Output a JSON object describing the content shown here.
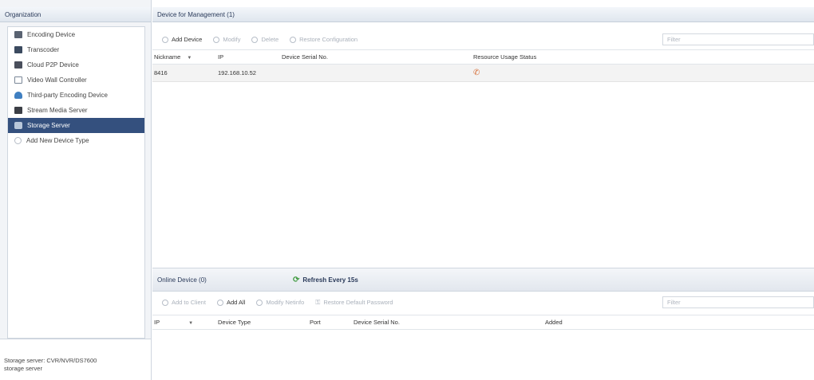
{
  "organization": {
    "header": "Organization",
    "items": [
      {
        "label": "Encoding Device",
        "icon": "encoding-device-icon"
      },
      {
        "label": "Transcoder",
        "icon": "transcoder-icon"
      },
      {
        "label": "Cloud P2P Device",
        "icon": "cloud-device-icon"
      },
      {
        "label": "Video Wall Controller",
        "icon": "video-wall-icon"
      },
      {
        "label": "Third-party Encoding Device",
        "icon": "third-party-icon"
      },
      {
        "label": "Stream Media Server",
        "icon": "stream-server-icon"
      },
      {
        "label": "Storage Server",
        "icon": "storage-server-icon",
        "selected": true
      },
      {
        "label": "Add New Device Type",
        "icon": "add-icon"
      }
    ],
    "footer": [
      "Storage server: CVR/NVR/DS7600",
      "storage server"
    ]
  },
  "management": {
    "header": "Device for Management (1)",
    "toolbar": {
      "add_device": "Add Device",
      "modify": "Modify",
      "delete": "Delete",
      "restore": "Restore Configuration"
    },
    "filter_placeholder": "Filter",
    "columns": [
      "Nickname",
      "IP",
      "Device Serial No.",
      "Resource Usage Status"
    ],
    "rows": [
      {
        "nickname": "8416",
        "ip": "192.168.10.52",
        "serial": ""
      }
    ]
  },
  "online": {
    "header": "Online Device (0)",
    "refresh": "Refresh Every 15s",
    "toolbar": {
      "add_to_client": "Add to Client",
      "add_all": "Add All",
      "modify_netinfo": "Modify Netinfo",
      "restore_password": "Restore Default Password"
    },
    "filter_placeholder": "Filter",
    "columns": [
      "IP",
      "Device Type",
      "Port",
      "Device Serial No.",
      "Added"
    ]
  },
  "colors": {
    "selected_bg": "#34507e",
    "header_text": "#2a3a5a",
    "refresh_icon": "#3f9a3f",
    "usage_icon": "#d6703a"
  }
}
